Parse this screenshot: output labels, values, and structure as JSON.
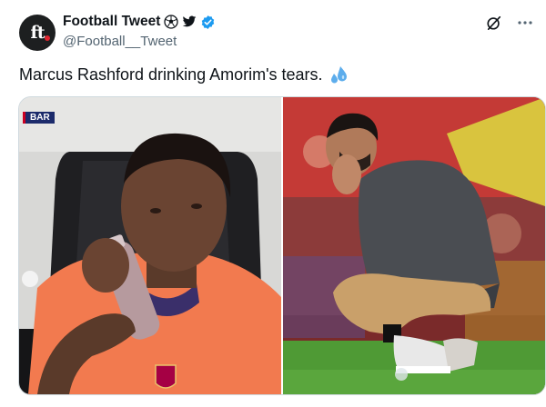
{
  "account": {
    "avatar_text": "ft",
    "display_name": "Football Tweet",
    "handle": "@Football__Tweet"
  },
  "icons": {
    "name_badges": [
      "soccer-ball-icon",
      "bird-icon",
      "verified-badge-icon"
    ],
    "header": [
      "grok-icon",
      "more-icon"
    ],
    "text_emoji": "sweat-droplets-icon"
  },
  "tweet": {
    "text": "Marcus Rashford drinking Amorim's tears."
  },
  "media": {
    "left_overlay_badge": "BAR"
  },
  "colors": {
    "verified": "#1d9bf0",
    "left_kit": "#f27a4f",
    "pitch": "#4f9a35"
  }
}
